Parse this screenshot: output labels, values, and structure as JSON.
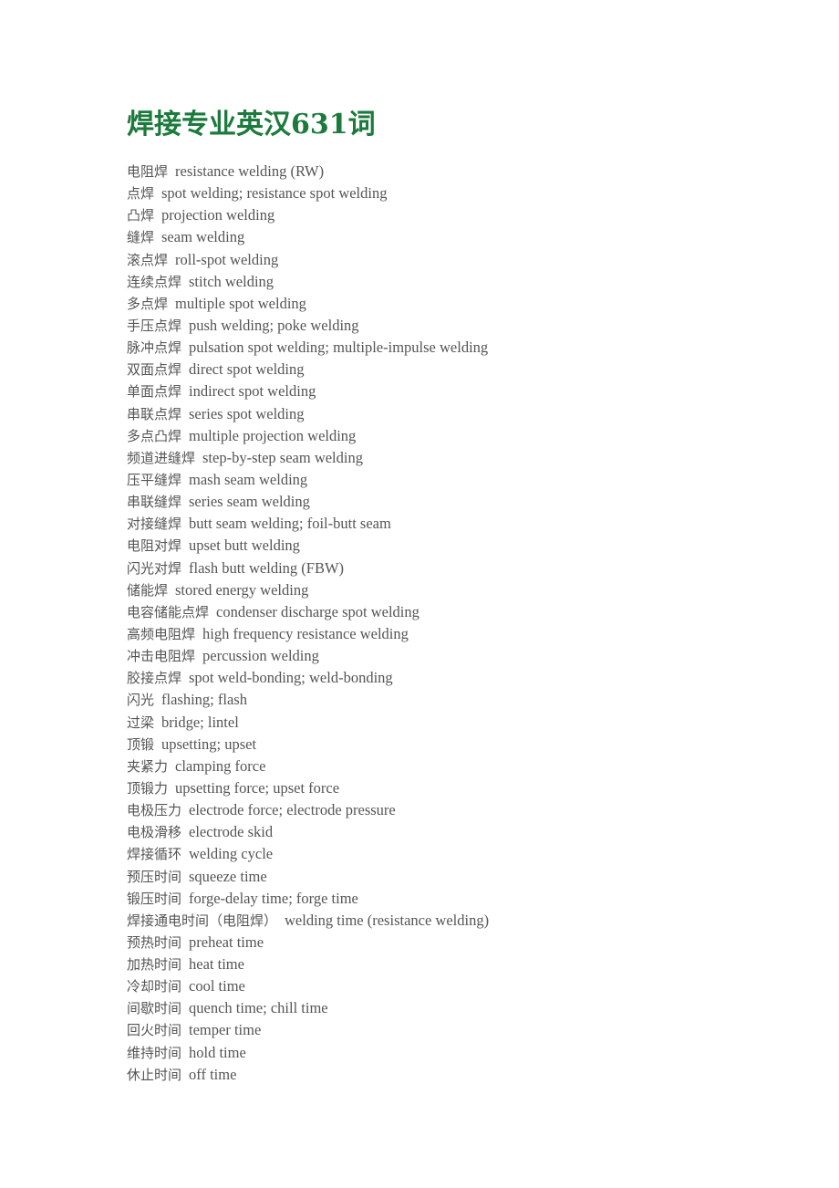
{
  "colors": {
    "title": "#1b7a3c",
    "body_text": "#555555",
    "background": "#ffffff"
  },
  "document": {
    "title": "焊接专业英汉631词",
    "entries": [
      {
        "zh": "电阻焊",
        "en": "resistance welding (RW)"
      },
      {
        "zh": "点焊",
        "en": "spot welding; resistance spot welding"
      },
      {
        "zh": "凸焊",
        "en": "projection welding"
      },
      {
        "zh": "缝焊",
        "en": "seam welding"
      },
      {
        "zh": "滚点焊",
        "en": "roll-spot welding"
      },
      {
        "zh": "连续点焊",
        "en": "stitch welding"
      },
      {
        "zh": "多点焊",
        "en": "multiple spot welding"
      },
      {
        "zh": "手压点焊",
        "en": "push welding; poke welding"
      },
      {
        "zh": "脉冲点焊",
        "en": "pulsation spot welding; multiple-impulse welding"
      },
      {
        "zh": "双面点焊",
        "en": "direct spot welding"
      },
      {
        "zh": "单面点焊",
        "en": "indirect spot welding"
      },
      {
        "zh": "串联点焊",
        "en": "series spot welding"
      },
      {
        "zh": "多点凸焊",
        "en": "multiple projection welding"
      },
      {
        "zh": "频道进缝焊",
        "en": "step-by-step seam welding"
      },
      {
        "zh": "压平缝焊",
        "en": "mash seam welding"
      },
      {
        "zh": "串联缝焊",
        "en": "series seam welding"
      },
      {
        "zh": "对接缝焊",
        "en": "butt seam welding; foil-butt seam"
      },
      {
        "zh": "电阻对焊",
        "en": "upset butt welding"
      },
      {
        "zh": "闪光对焊",
        "en": "flash butt welding (FBW)"
      },
      {
        "zh": "储能焊",
        "en": "stored energy welding"
      },
      {
        "zh": "电容储能点焊",
        "en": "condenser discharge spot welding"
      },
      {
        "zh": "高频电阻焊",
        "en": "high frequency resistance welding"
      },
      {
        "zh": "冲击电阻焊",
        "en": "percussion welding"
      },
      {
        "zh": "胶接点焊",
        "en": "spot weld-bonding; weld-bonding"
      },
      {
        "zh": "闪光",
        "en": "flashing; flash"
      },
      {
        "zh": "过梁",
        "en": "bridge; lintel"
      },
      {
        "zh": "顶锻",
        "en": "upsetting; upset"
      },
      {
        "zh": "夹紧力",
        "en": "clamping force"
      },
      {
        "zh": "顶锻力",
        "en": "upsetting force; upset force"
      },
      {
        "zh": "电极压力",
        "en": "electrode force; electrode pressure"
      },
      {
        "zh": "电极滑移",
        "en": "electrode skid"
      },
      {
        "zh": "焊接循环",
        "en": "welding cycle"
      },
      {
        "zh": "预压时间",
        "en": "squeeze time"
      },
      {
        "zh": "锻压时间",
        "en": "forge-delay time; forge time"
      },
      {
        "zh": "焊接通电时间（电阻焊）",
        "en": "welding time (resistance welding)"
      },
      {
        "zh": "预热时间",
        "en": "preheat time"
      },
      {
        "zh": "加热时间",
        "en": "heat time"
      },
      {
        "zh": "冷却时间",
        "en": "cool time"
      },
      {
        "zh": "间歇时间",
        "en": "quench time; chill time"
      },
      {
        "zh": "回火时间",
        "en": "temper time"
      },
      {
        "zh": "维持时间",
        "en": "hold time"
      },
      {
        "zh": "休止时间",
        "en": "off time"
      }
    ]
  }
}
